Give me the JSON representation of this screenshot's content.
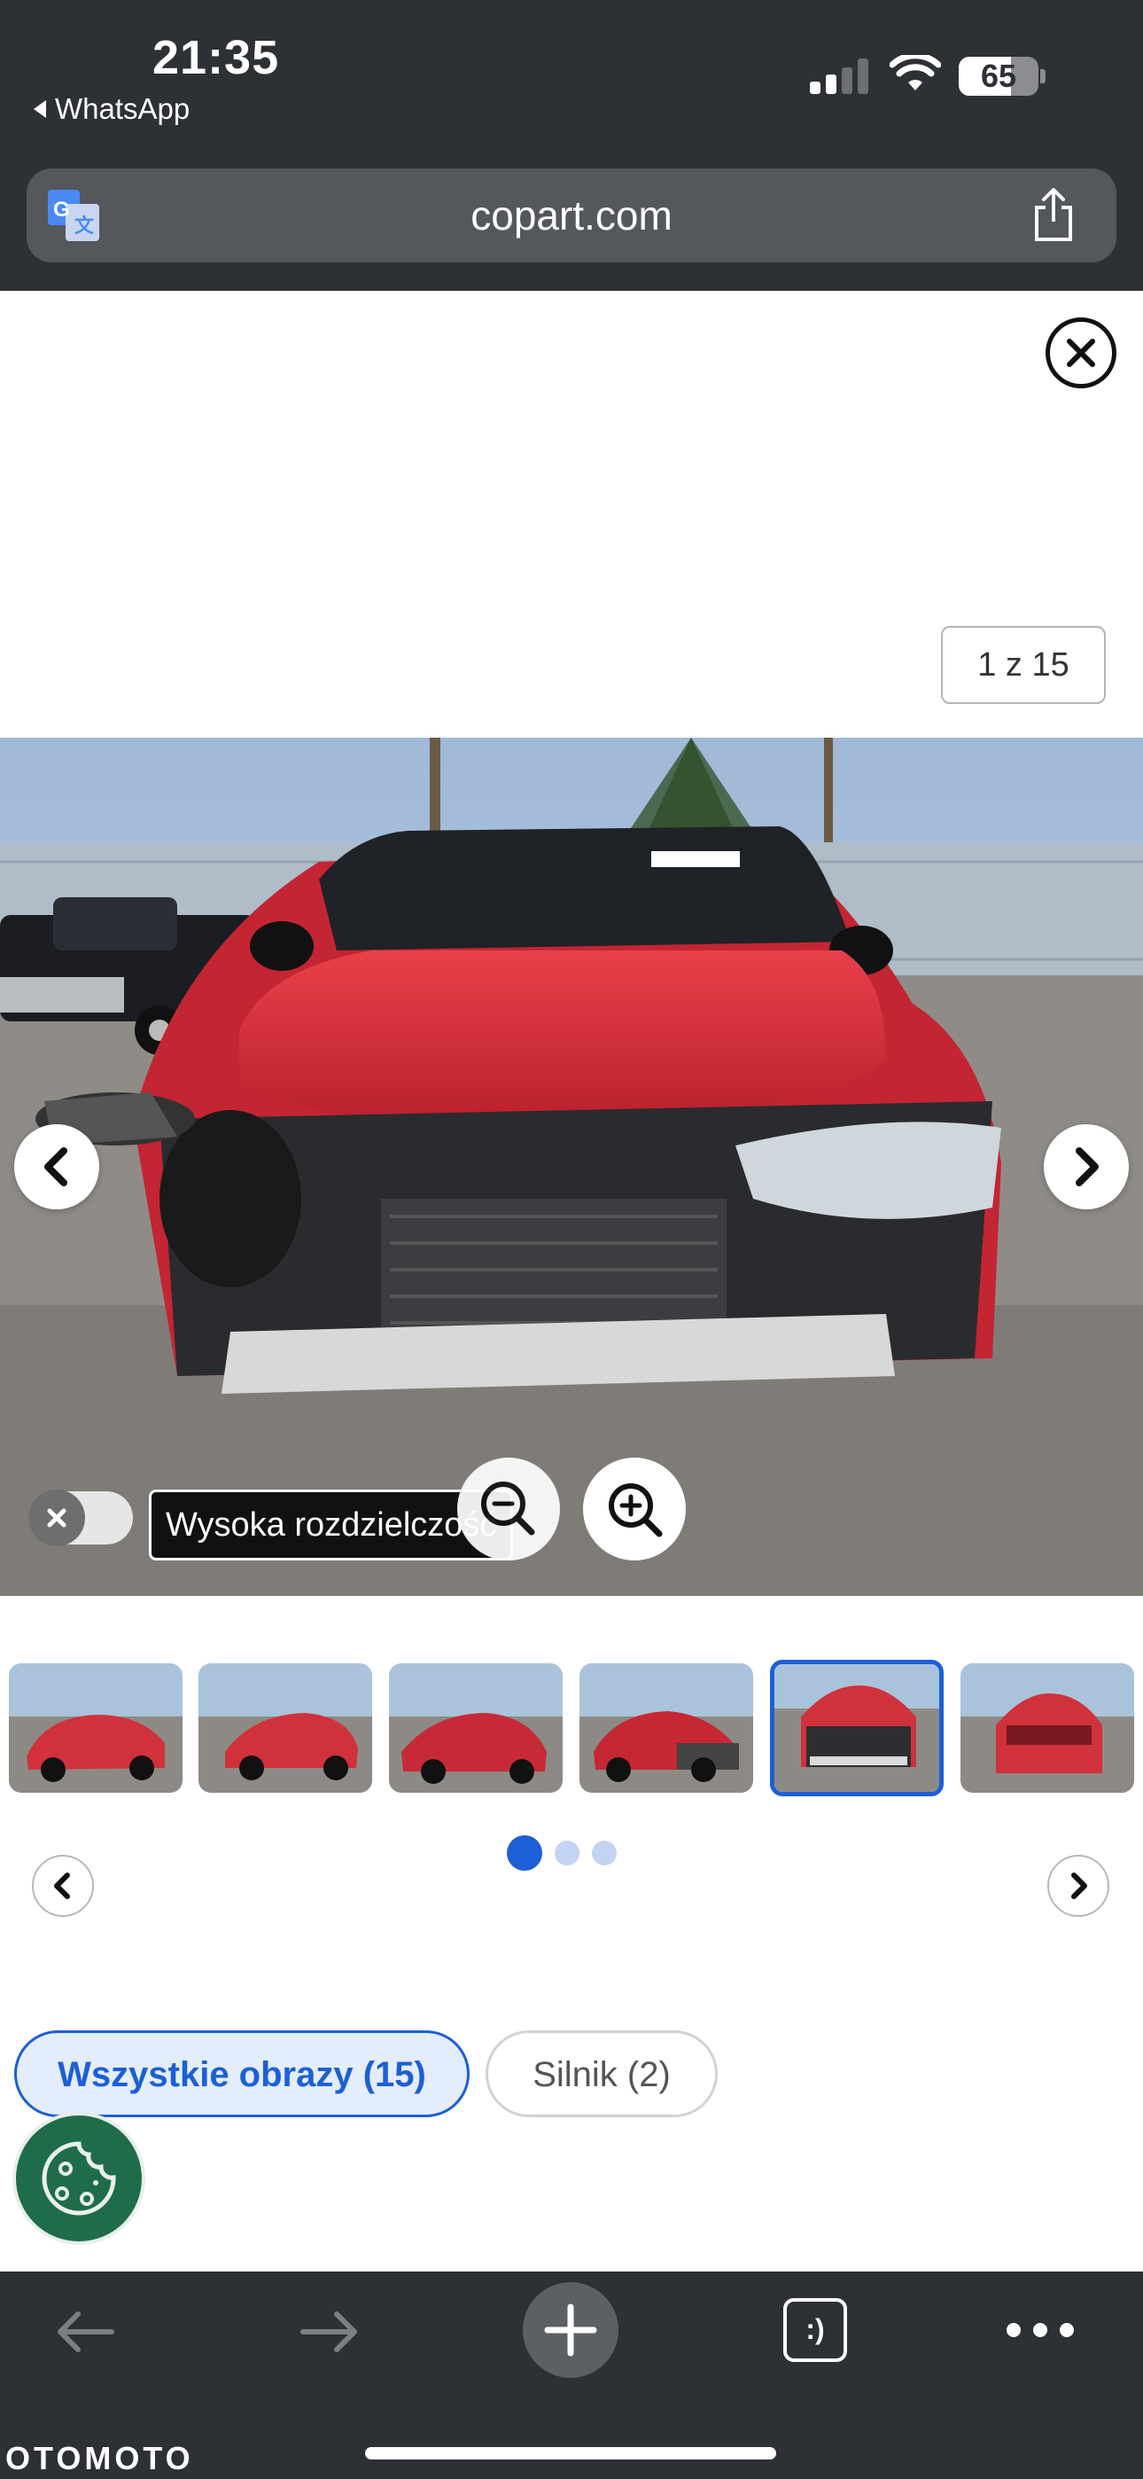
{
  "status_bar": {
    "time": "21:35",
    "back_app": "WhatsApp",
    "battery_level": "65",
    "signal_bars_active": 2,
    "signal_bars_total": 4
  },
  "browser": {
    "url": "copart.com"
  },
  "viewer": {
    "image_counter": "1 z 15",
    "high_resolution_label": "Wysoka rozdzielczość",
    "high_resolution_enabled": false
  },
  "thumbnails": {
    "items": [
      {
        "label": "thumbnail-1",
        "active": false
      },
      {
        "label": "thumbnail-2",
        "active": false
      },
      {
        "label": "thumbnail-3",
        "active": false
      },
      {
        "label": "thumbnail-4",
        "active": false
      },
      {
        "label": "thumbnail-5",
        "active": true
      },
      {
        "label": "thumbnail-6",
        "active": false
      }
    ],
    "pages_total": 3,
    "page_current": 1
  },
  "filters": {
    "all_images": "Wszystkie obrazy (15)",
    "engine": "Silnik  (2)"
  },
  "watermark": "OTOMOTO",
  "colors": {
    "chrome": "#2d3034",
    "accent": "#1c5fd6",
    "car_red": "#d62a35",
    "cookie_green": "#1f6c4a"
  }
}
